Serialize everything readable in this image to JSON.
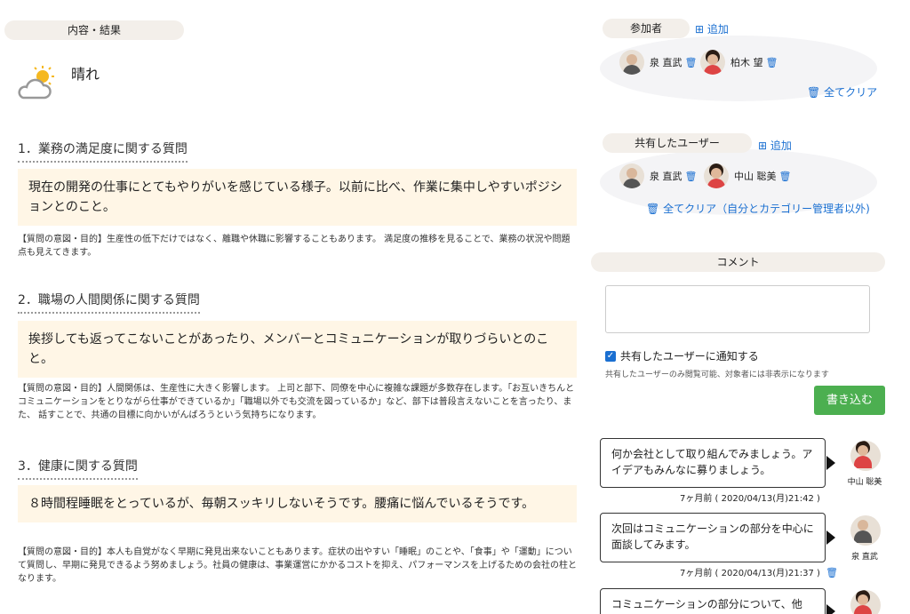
{
  "left": {
    "section_title": "内容・結果",
    "weather": {
      "icon": "partly-cloudy-icon",
      "label": "晴れ"
    },
    "questions": [
      {
        "title": "1．業務の満足度に関する質問",
        "answer": "現在の開発の仕事にとてもやりがいを感じている様子。以前に比べ、作業に集中しやすいポジションとのこと。",
        "intent": "【質問の意図・目的】生産性の低下だけではなく、離職や休職に影響することもあります。 満足度の推移を見ることで、業務の状況や問題点も見えてきます。"
      },
      {
        "title": "2．職場の人間関係に関する質問",
        "answer": "挨拶しても返ってこないことがあったり、メンバーとコミュニケーションが取りづらいとのこと。",
        "intent": "【質問の意図・目的】人間関係は、生産性に大きく影響します。 上司と部下、同僚を中心に複雑な課題が多数存在します。「お互いきちんとコミュニケーションをとりながら仕事ができているか」「職場以外でも交流を図っているか」など、部下は普段言えないことを言ったり、また、 話すことで、共通の目標に向かいがんばろうという気持ちになります。"
      },
      {
        "title": "3．健康に関する質問",
        "answer": "８時間程睡眠をとっているが、毎朝スッキリしないそうです。腰痛に悩んでいるそうです。",
        "intent": "【質問の意図・目的】本人も自覚がなく早期に発見出来ないこともあります。症状の出やすい「睡眠」のことや、「食事」や「運動」について質問し、早期に発見できるよう努めましょう。社員の健康は、事業運営にかかるコストを抑え、パフォーマンスを上げるための会社の柱となります。"
      }
    ]
  },
  "participants": {
    "title": "参加者",
    "add_label": "追加",
    "members": [
      {
        "name": "泉 直武"
      },
      {
        "name": "柏木 望"
      }
    ],
    "clear_label": "全てクリア"
  },
  "shared": {
    "title": "共有したユーザー",
    "add_label": "追加",
    "members": [
      {
        "name": "泉 直武"
      },
      {
        "name": "中山 聡美"
      }
    ],
    "clear_label": "全てクリア（自分とカテゴリー管理者以外)"
  },
  "comments": {
    "title": "コメント",
    "notify_label": "共有したユーザーに通知する",
    "note": "共有したユーザーのみ閲覧可能、対象者には非表示になります",
    "submit_label": "書き込む",
    "items": [
      {
        "text": "何か会社として取り組んでみましょう。アイデアもみんなに募りましょう。",
        "author": "中山 聡美",
        "time": "7ヶ月前 ( 2020/04/13(月)21:42 )"
      },
      {
        "text": "次回はコミュニケーションの部分を中心に面談してみます。",
        "author": "泉 直武",
        "time": "7ヶ月前 ( 2020/04/13(月)21:37 )"
      },
      {
        "text": "コミュニケーションの部分について、他",
        "author": "",
        "time": ""
      }
    ]
  },
  "icons": {
    "add": "plus-square-icon",
    "trash": "trash-icon",
    "check": "checkbox-checked-icon"
  },
  "colors": {
    "accent": "#1a6fd1",
    "submit": "#4caf50",
    "answer_bg": "#fff6e6",
    "pill_bg": "#f3efea"
  }
}
